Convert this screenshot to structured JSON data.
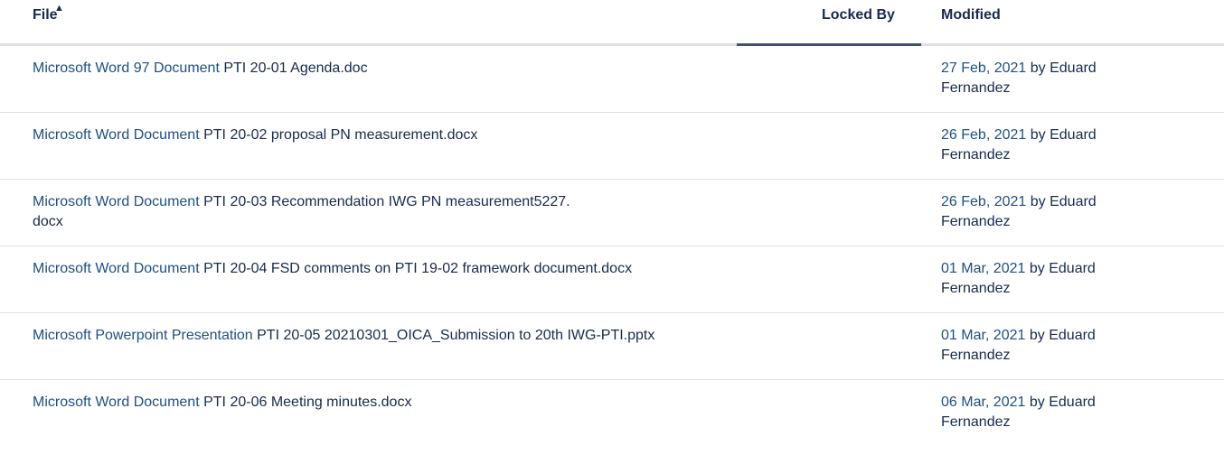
{
  "header": {
    "file": "File",
    "locked_by": "Locked By",
    "modified": "Modified"
  },
  "rows": [
    {
      "type": "Microsoft Word 97 Document",
      "name": "PTI 20-01 Agenda.doc",
      "date": "27 Feb, 2021",
      "by": "by",
      "author": "Eduard Fernandez"
    },
    {
      "type": "Microsoft Word Document",
      "name": "PTI 20-02 proposal PN measurement.docx",
      "date": "26 Feb, 2021",
      "by": "by",
      "author": "Eduard Fernandez"
    },
    {
      "type": "Microsoft Word Document",
      "name": "PTI 20-03 Recommendation IWG PN measurement5227.\ndocx",
      "date": "26 Feb, 2021",
      "by": "by",
      "author": "Eduard Fernandez"
    },
    {
      "type": "Microsoft Word Document",
      "name": "PTI 20-04 FSD comments on PTI 19-02 framework document.docx",
      "date": "01 Mar, 2021",
      "by": "by",
      "author": "Eduard Fernandez"
    },
    {
      "type": "Microsoft Powerpoint Presentation",
      "name": "PTI 20-05 20210301_OICA_Submission to 20th IWG-PTI.pptx",
      "date": "01 Mar, 2021",
      "by": "by",
      "author": "Eduard Fernandez"
    },
    {
      "type": "Microsoft Word Document",
      "name": "PTI 20-06 Meeting minutes.docx",
      "date": "06 Mar, 2021",
      "by": "by",
      "author": "Eduard Fernandez"
    }
  ],
  "icons": {
    "sort": "sort-ascending-icon"
  },
  "colors": {
    "link": "#205081",
    "text": "#172b4d",
    "border": "#dfe1e6",
    "active_header": "#42526e"
  }
}
